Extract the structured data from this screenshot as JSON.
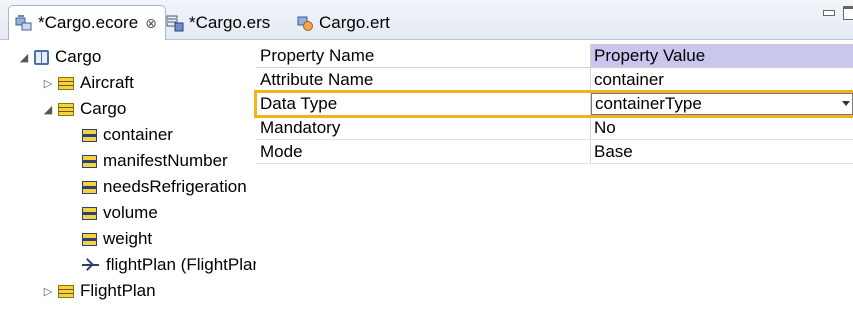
{
  "tabs": [
    {
      "label": "*Cargo.ecore",
      "icon": "ecore-model-icon",
      "active": true,
      "close": "⊗"
    },
    {
      "label": "*Cargo.ers",
      "icon": "ers-model-icon",
      "active": false
    },
    {
      "label": "Cargo.ert",
      "icon": "ert-model-icon",
      "active": false
    }
  ],
  "tree": {
    "root": {
      "label": "Cargo",
      "icon": "package-icon",
      "expanded": true
    },
    "items": [
      {
        "label": "Aircraft",
        "icon": "class-icon",
        "expanded": false
      },
      {
        "label": "Cargo",
        "icon": "class-icon",
        "expanded": true
      },
      {
        "label": "container",
        "icon": "attribute-icon"
      },
      {
        "label": "manifestNumber",
        "icon": "attribute-icon"
      },
      {
        "label": "needsRefrigeration",
        "icon": "attribute-icon"
      },
      {
        "label": "volume",
        "icon": "attribute-icon"
      },
      {
        "label": "weight",
        "icon": "attribute-icon"
      },
      {
        "label": "flightPlan (FlightPlan)",
        "icon": "reference-icon"
      },
      {
        "label": "FlightPlan",
        "icon": "class-icon",
        "expanded": false
      }
    ]
  },
  "properties": {
    "headers": {
      "name": "Property Name",
      "value": "Property Value"
    },
    "rows": [
      {
        "name": "Attribute Name",
        "value": "container"
      },
      {
        "name": "Data Type",
        "value": "containerType",
        "selected": true
      },
      {
        "name": "Mandatory",
        "value": "No"
      },
      {
        "name": "Mode",
        "value": "Base"
      }
    ]
  },
  "colors": {
    "header_value_bg": "#c9c7ee",
    "selection_outline": "#f2b41a"
  }
}
